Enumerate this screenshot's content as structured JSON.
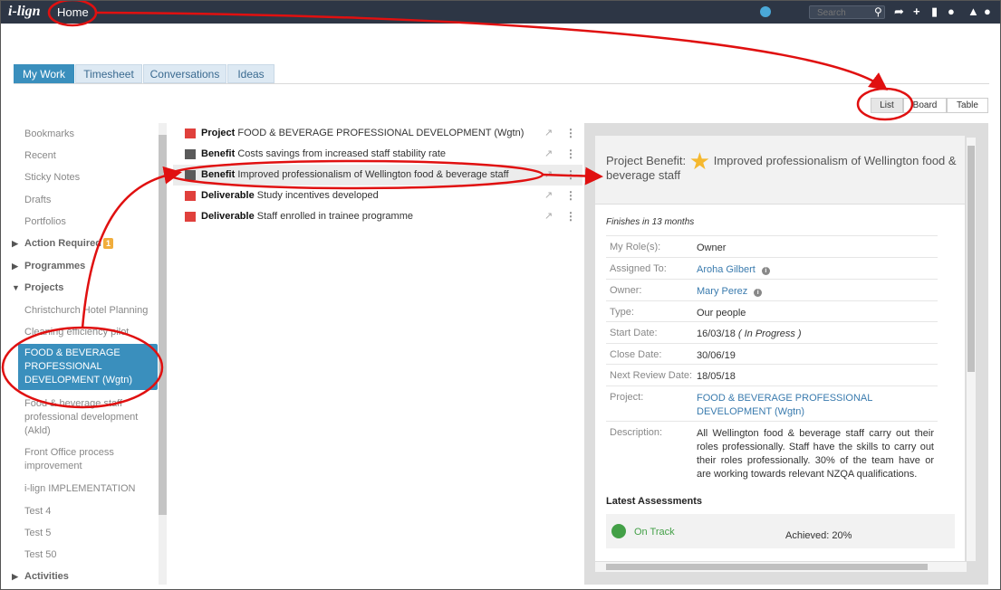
{
  "topbar": {
    "logo": "i-lign",
    "home": "Home",
    "search_placeholder": "Search"
  },
  "tabs": [
    {
      "label": "My Work"
    },
    {
      "label": "Timesheet"
    },
    {
      "label": "Conversations"
    },
    {
      "label": "Ideas"
    }
  ],
  "views": {
    "list": "List",
    "board": "Board",
    "table": "Table"
  },
  "sidebar": {
    "items": [
      {
        "label": "Bookmarks"
      },
      {
        "label": "Recent"
      },
      {
        "label": "Sticky Notes"
      },
      {
        "label": "Drafts"
      },
      {
        "label": "Portfolios"
      },
      {
        "label": "Action Required",
        "badge": "1"
      },
      {
        "label": "Programmes"
      },
      {
        "label": "Projects"
      },
      {
        "label": "Christchurch Hotel Planning"
      },
      {
        "label": "Cleaning efficiency pilot"
      },
      {
        "label": "FOOD & BEVERAGE PROFESSIONAL DEVELOPMENT (Wgtn)"
      },
      {
        "label": "Food & beverage staff professional development (Akld)"
      },
      {
        "label": "Front Office process improvement"
      },
      {
        "label": "i-lign IMPLEMENTATION"
      },
      {
        "label": "Test 4"
      },
      {
        "label": "Test 5"
      },
      {
        "label": "Test 50"
      },
      {
        "label": "Activities"
      }
    ]
  },
  "list": [
    {
      "type": "Project",
      "text": "FOOD & BEVERAGE PROFESSIONAL DEVELOPMENT (Wgtn)",
      "color": "#e0403c"
    },
    {
      "type": "Benefit",
      "text": "Costs savings from increased staff stability rate",
      "color": "#5a5a5a"
    },
    {
      "type": "Benefit",
      "text": "Improved professionalism of Wellington food & beverage staff",
      "color": "#5a5a5a"
    },
    {
      "type": "Deliverable",
      "text": "Study incentives developed",
      "color": "#e0403c"
    },
    {
      "type": "Deliverable",
      "text": "Staff enrolled in trainee programme",
      "color": "#e0403c"
    }
  ],
  "detail": {
    "title_prefix": "Project Benefit:",
    "title": "Improved professionalism of Wellington food & beverage staff",
    "finishes": "Finishes in 13 months",
    "rows": {
      "my_role": {
        "label": "My Role(s):",
        "value": "Owner"
      },
      "assigned_to": {
        "label": "Assigned To:",
        "value": "Aroha Gilbert"
      },
      "owner": {
        "label": "Owner:",
        "value": "Mary Perez"
      },
      "type": {
        "label": "Type:",
        "value": "Our people"
      },
      "start_date": {
        "label": "Start Date:",
        "value": "16/03/18",
        "status": "( In Progress )"
      },
      "close_date": {
        "label": "Close Date:",
        "value": "30/06/19"
      },
      "next_review": {
        "label": "Next Review Date:",
        "value": "18/05/18"
      },
      "project": {
        "label": "Project:",
        "value": "FOOD & BEVERAGE PROFESSIONAL DEVELOPMENT (Wgtn)"
      },
      "description": {
        "label": "Description:",
        "value": "All Wellington food & beverage staff carry out their roles professionally. Staff have the skills to carry out their roles professionally. 30% of the team have or are working towards relevant NZQA qualifications."
      }
    },
    "assessments_title": "Latest Assessments",
    "assessment_status": "On Track",
    "assessment_achieved": "Achieved: 20%"
  },
  "colors": {
    "accent": "#3a8fbd",
    "annotation": "#e01010",
    "status_green": "#43a047",
    "star": "#f5b82e"
  }
}
